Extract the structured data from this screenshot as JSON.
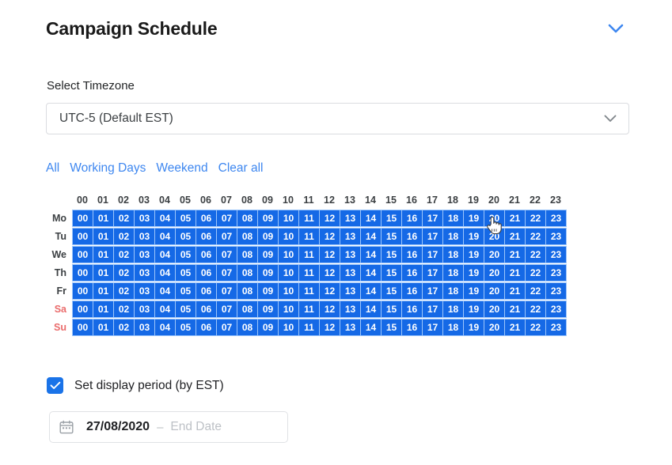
{
  "header": {
    "title": "Campaign Schedule",
    "collapse_icon": "chevron-down-icon",
    "collapse_color": "#3e87f0"
  },
  "timezone": {
    "label": "Select Timezone",
    "selected": "UTC-5 (Default EST)",
    "caret_icon": "chevron-down-icon"
  },
  "quick_links": [
    {
      "label": "All"
    },
    {
      "label": "Working Days"
    },
    {
      "label": "Weekend"
    },
    {
      "label": "Clear all"
    }
  ],
  "schedule_grid": {
    "hours": [
      "00",
      "01",
      "02",
      "03",
      "04",
      "05",
      "06",
      "07",
      "08",
      "09",
      "10",
      "11",
      "12",
      "13",
      "14",
      "15",
      "16",
      "17",
      "18",
      "19",
      "20",
      "21",
      "22",
      "23"
    ],
    "selected_color": "#1569e6",
    "grid_background": "#9dc6fb",
    "weekend_label_color": "#ea6b6b",
    "rows": [
      {
        "day": "Mo",
        "weekend": false,
        "selected": [
          true,
          true,
          true,
          true,
          true,
          true,
          true,
          true,
          true,
          true,
          true,
          true,
          true,
          true,
          true,
          true,
          true,
          true,
          true,
          true,
          true,
          true,
          true,
          true
        ]
      },
      {
        "day": "Tu",
        "weekend": false,
        "selected": [
          true,
          true,
          true,
          true,
          true,
          true,
          true,
          true,
          true,
          true,
          true,
          true,
          true,
          true,
          true,
          true,
          true,
          true,
          true,
          true,
          true,
          true,
          true,
          true
        ]
      },
      {
        "day": "We",
        "weekend": false,
        "selected": [
          true,
          true,
          true,
          true,
          true,
          true,
          true,
          true,
          true,
          true,
          true,
          true,
          true,
          true,
          true,
          true,
          true,
          true,
          true,
          true,
          true,
          true,
          true,
          true
        ]
      },
      {
        "day": "Th",
        "weekend": false,
        "selected": [
          true,
          true,
          true,
          true,
          true,
          true,
          true,
          true,
          true,
          true,
          true,
          true,
          true,
          true,
          true,
          true,
          true,
          true,
          true,
          true,
          true,
          true,
          true,
          true
        ]
      },
      {
        "day": "Fr",
        "weekend": false,
        "selected": [
          true,
          true,
          true,
          true,
          true,
          true,
          true,
          true,
          true,
          true,
          true,
          true,
          true,
          true,
          true,
          true,
          true,
          true,
          true,
          true,
          true,
          true,
          true,
          true
        ]
      },
      {
        "day": "Sa",
        "weekend": true,
        "selected": [
          true,
          true,
          true,
          true,
          true,
          true,
          true,
          true,
          true,
          true,
          true,
          true,
          true,
          true,
          true,
          true,
          true,
          true,
          true,
          true,
          true,
          true,
          true,
          true
        ]
      },
      {
        "day": "Su",
        "weekend": true,
        "selected": [
          true,
          true,
          true,
          true,
          true,
          true,
          true,
          true,
          true,
          true,
          true,
          true,
          true,
          true,
          true,
          true,
          true,
          true,
          true,
          true,
          true,
          true,
          true,
          true
        ]
      }
    ],
    "cursor": {
      "icon": "pointing-hand-cursor",
      "over_day": "Mo",
      "over_hour": "20"
    }
  },
  "display_period": {
    "checked": true,
    "label": "Set display period (by EST)",
    "check_icon": "check-icon",
    "accent": "#1a73e8"
  },
  "date_range": {
    "calendar_icon": "calendar-icon",
    "start_value": "27/08/2020",
    "separator": "–",
    "end_placeholder": "End Date"
  }
}
